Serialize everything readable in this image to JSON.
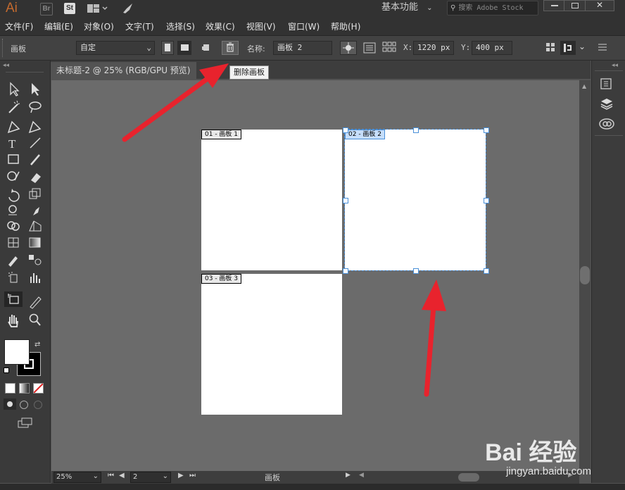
{
  "app": {
    "logo": "Ai",
    "bridge_label": "Br",
    "stock_label": "St",
    "workspace": "基本功能",
    "search_placeholder": "搜索 Adobe Stock"
  },
  "menu": [
    "文件(F)",
    "编辑(E)",
    "对象(O)",
    "文字(T)",
    "选择(S)",
    "效果(C)",
    "视图(V)",
    "窗口(W)",
    "帮助(H)"
  ],
  "control": {
    "panel_label": "画板",
    "preset_value": "自定",
    "name_label": "名称:",
    "name_value": "画板 2",
    "x_label": "X:",
    "x_value": "1220 px",
    "y_label": "Y:",
    "y_value": "400 px"
  },
  "tooltip": "删除画板",
  "document": {
    "tab_title": "未标题-2 @ 25% (RGB/GPU 预览)"
  },
  "artboards": [
    {
      "label": "01 - 画板 1",
      "selected": false
    },
    {
      "label": "02 - 画板 2",
      "selected": true
    },
    {
      "label": "03 - 画板 3",
      "selected": false
    }
  ],
  "status": {
    "zoom": "25%",
    "artboard_num": "2",
    "tool_name": "画板"
  },
  "watermark": {
    "brand": "Bai 经验",
    "url": "jingyan.baidu.com"
  },
  "colors": {
    "accent_arrow": "#e8232d",
    "selection": "#4a90d9",
    "logo": "#c46a2e"
  }
}
